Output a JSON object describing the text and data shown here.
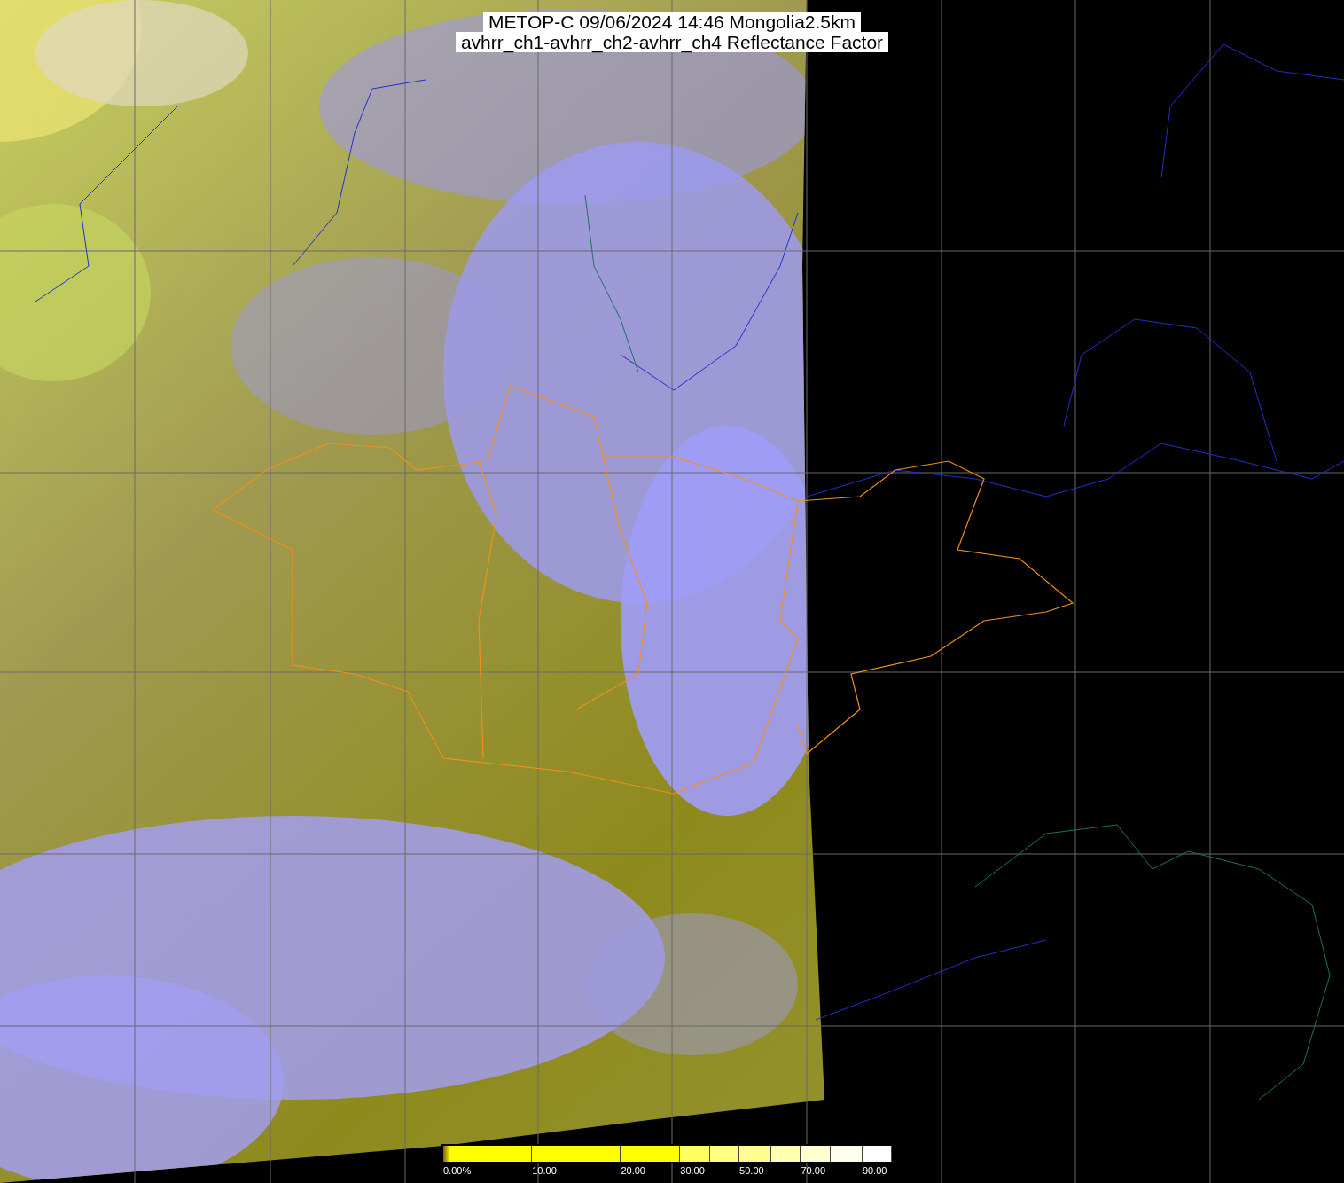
{
  "title": {
    "lines": [
      "METOP-C 09/06/2024 14:46 Mongolia2.5km",
      "avhrr_ch1-avhrr_ch2-avhrr_ch4 Reflectance Factor"
    ]
  },
  "colorbar": {
    "labels": [
      "0.00%",
      "10.00",
      "20.00",
      "30.00",
      "50.00",
      "70.00",
      "90.00"
    ]
  }
}
